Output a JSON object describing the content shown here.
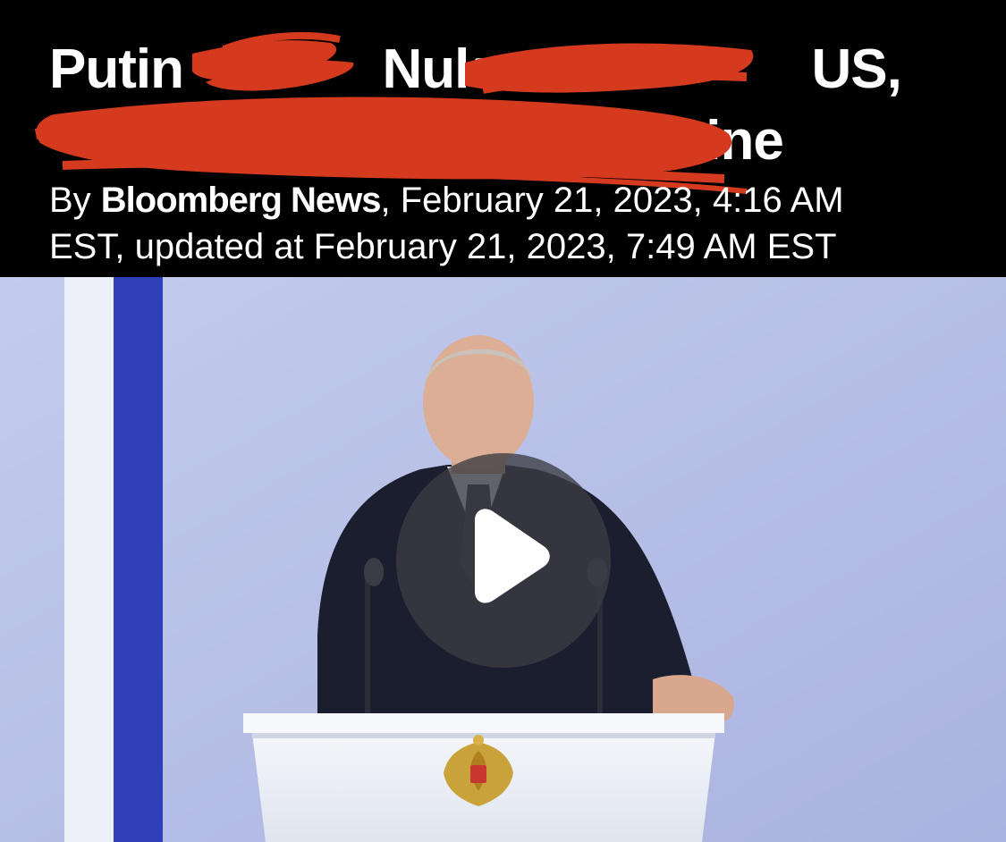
{
  "article": {
    "headline_line1": {
      "word1": "Putin",
      "word2": "Nuke",
      "word3": "US,"
    },
    "headline_line2": {
      "visible_end": "ine"
    },
    "byline": {
      "prefix": "By ",
      "author": "Bloomberg News",
      "published": ", February 21, 2023, 4:16 AM",
      "updated": "EST, updated at February 21, 2023, 7:49 AM EST"
    }
  },
  "video": {
    "play_icon": "play-icon",
    "colors": {
      "backdrop": "#b6bfe6",
      "flag_blue": "#2f3fb7",
      "suit": "#1a1e2e",
      "podium": "#eef1f6",
      "scribble": "#d53a1e"
    }
  }
}
